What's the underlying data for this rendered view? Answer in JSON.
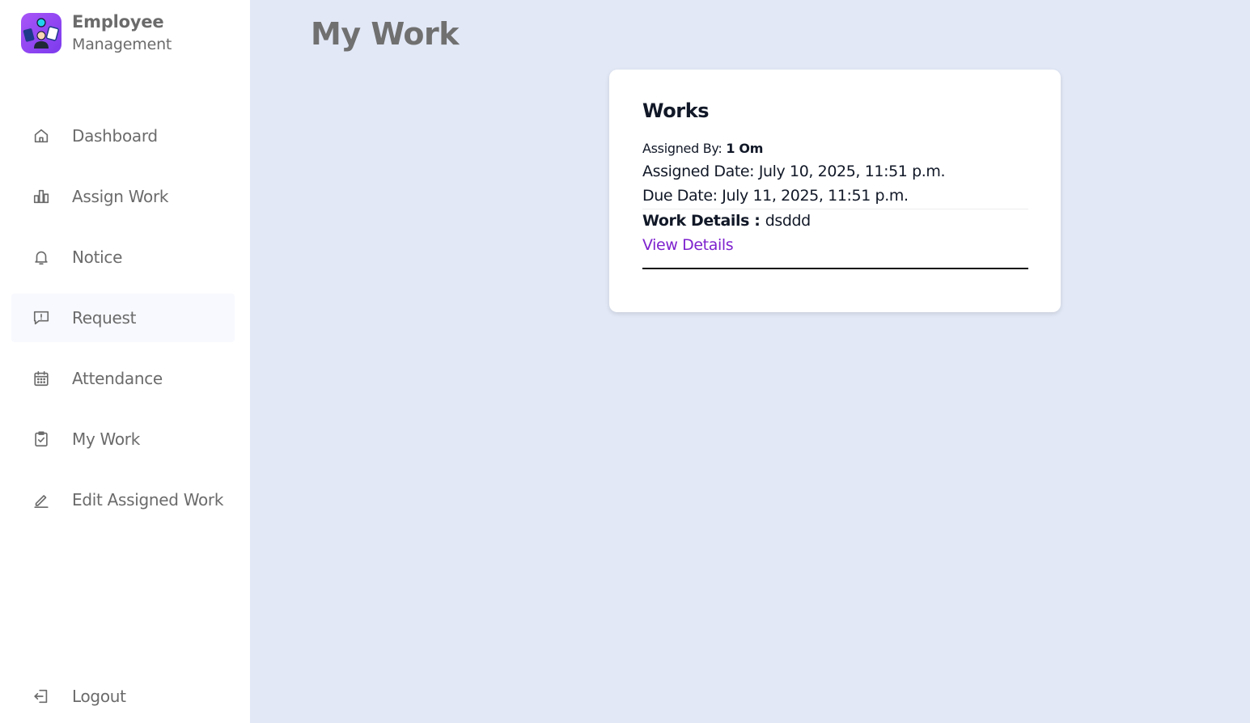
{
  "brand": {
    "title": "Employee",
    "subtitle": "Management",
    "logo_icon": "team-logo-icon"
  },
  "sidebar": {
    "items": [
      {
        "label": "Dashboard",
        "icon": "home-icon"
      },
      {
        "label": "Assign Work",
        "icon": "bar-chart-icon"
      },
      {
        "label": "Notice",
        "icon": "bell-icon"
      },
      {
        "label": "Request",
        "icon": "message-alert-icon",
        "active": true
      },
      {
        "label": "Attendance",
        "icon": "calendar-icon"
      },
      {
        "label": "My Work",
        "icon": "clipboard-check-icon"
      },
      {
        "label": "Edit Assigned Work",
        "icon": "pencil-icon"
      }
    ],
    "logout": {
      "label": "Logout",
      "icon": "logout-icon"
    }
  },
  "page": {
    "title": "My Work"
  },
  "card": {
    "title": "Works",
    "assigned_by_label": "Assigned By: ",
    "assigned_by_value": "1 Om",
    "assigned_date": "Assigned Date: July 10, 2025, 11:51 p.m.",
    "due_date": "Due Date: July 11, 2025, 11:51 p.m.",
    "work_details_label": "Work Details : ",
    "work_details_value": "dsddd",
    "view_details": "View Details"
  },
  "colors": {
    "background": "#e2e8f6",
    "accent": "#7e22ce",
    "sidebar": "#ffffff",
    "text_muted": "#6b6b6b"
  }
}
